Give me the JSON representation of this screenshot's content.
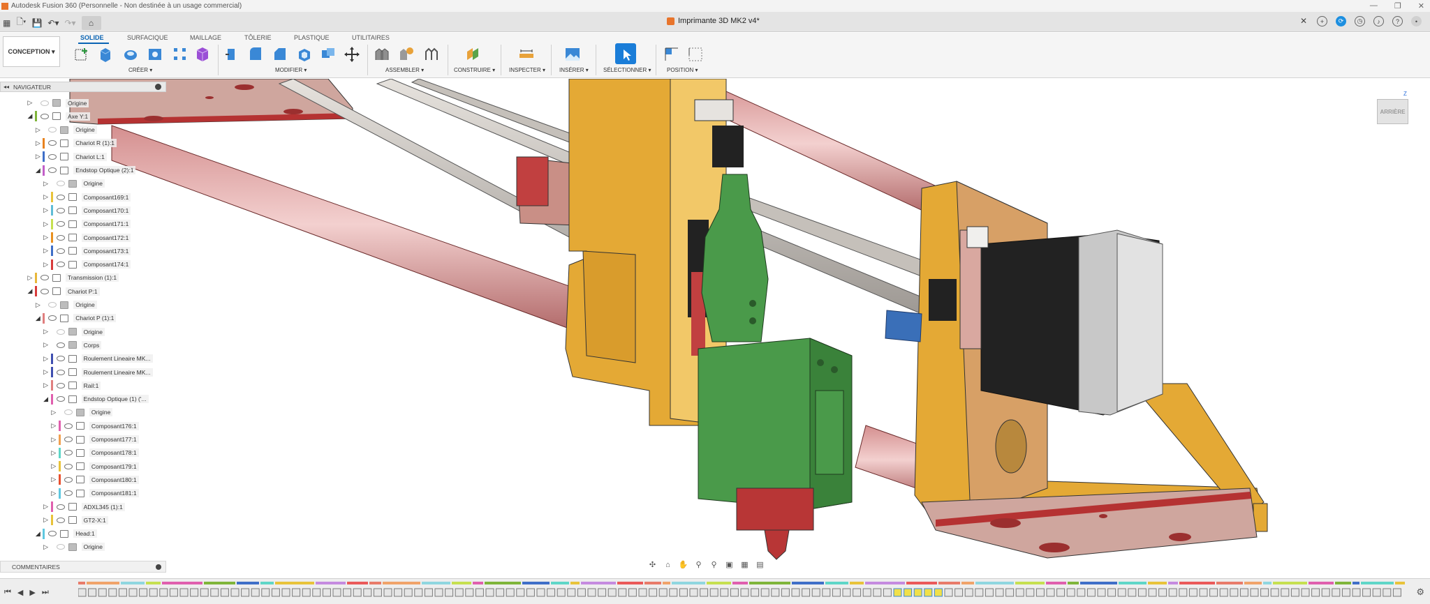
{
  "window": {
    "title": "Autodesk Fusion 360 (Personnelle - Non destinée à un usage commercial)",
    "controls": [
      "—",
      "❐",
      "✕"
    ]
  },
  "tabbar": {
    "document_title": "Imprimante 3D MK2 v4*",
    "close_glyph": "✕",
    "right_icons": [
      "plus-icon",
      "sync-icon",
      "clock-icon",
      "bell-icon",
      "help-icon",
      "user-icon"
    ]
  },
  "ribbon": {
    "workspace": "CONCEPTION",
    "tabs": [
      "SOLIDE",
      "SURFACIQUE",
      "MAILLAGE",
      "TÔLERIE",
      "PLASTIQUE",
      "UTILITAIRES"
    ],
    "active_tab": "SOLIDE",
    "groups": [
      "CRÉER",
      "MODIFIER",
      "ASSEMBLER",
      "CONSTRUIRE",
      "INSPECTER",
      "INSÉRER",
      "SÉLECTIONNER",
      "POSITION"
    ]
  },
  "browser": {
    "title": "NAVIGATEUR",
    "items": [
      {
        "label": "Origine",
        "type": "folder",
        "color": "",
        "expanded": false,
        "visible": false
      },
      {
        "label": "Axe Y:1",
        "type": "component",
        "color": "#7fb53a",
        "expanded": true,
        "visible": true
      },
      {
        "label": "Origine",
        "type": "folder",
        "color": "",
        "expanded": false,
        "visible": false
      },
      {
        "label": "Chariot R (1):1",
        "type": "component",
        "color": "#e8821e",
        "expanded": false,
        "visible": true
      },
      {
        "label": "Chariot L:1",
        "type": "component",
        "color": "#3f6fc8",
        "expanded": false,
        "visible": true
      },
      {
        "label": "Endstop Optique (2):1",
        "type": "component",
        "color": "#c25fc8",
        "expanded": true,
        "visible": true
      },
      {
        "label": "Origine",
        "type": "folder",
        "color": "",
        "expanded": false,
        "visible": false
      },
      {
        "label": "Composant169:1",
        "type": "body",
        "color": "#e8c33a",
        "expanded": false,
        "visible": true
      },
      {
        "label": "Composant170:1",
        "type": "body",
        "color": "#5fbcd6",
        "expanded": false,
        "visible": true
      },
      {
        "label": "Composant171:1",
        "type": "body",
        "color": "#c6e050",
        "expanded": false,
        "visible": true
      },
      {
        "label": "Composant172:1",
        "type": "body",
        "color": "#e8901f",
        "expanded": false,
        "visible": true
      },
      {
        "label": "Composant173:1",
        "type": "body",
        "color": "#3f6fc8",
        "expanded": false,
        "visible": true
      },
      {
        "label": "Composant174:1",
        "type": "body",
        "color": "#d83b3b",
        "expanded": false,
        "visible": true
      },
      {
        "label": "Transmission (1):1",
        "type": "component",
        "color": "#e8b73a",
        "expanded": false,
        "visible": true
      },
      {
        "label": "Chariot P:1",
        "type": "component",
        "color": "#d83b3b",
        "expanded": true,
        "visible": true
      },
      {
        "label": "Origine",
        "type": "folder",
        "color": "",
        "expanded": false,
        "visible": false
      },
      {
        "label": "Chariot P (1):1",
        "type": "component",
        "color": "#e07f7f",
        "expanded": true,
        "visible": true
      },
      {
        "label": "Origine",
        "type": "folder",
        "color": "",
        "expanded": false,
        "visible": false
      },
      {
        "label": "Corps",
        "type": "folder",
        "color": "",
        "expanded": false,
        "visible": true
      },
      {
        "label": "Roulement Lineaire MK...",
        "type": "component",
        "color": "#3f4fb0",
        "expanded": false,
        "visible": true
      },
      {
        "label": "Roulement Lineaire MK...",
        "type": "component",
        "color": "#3f4fb0",
        "expanded": false,
        "visible": true
      },
      {
        "label": "Rail:1",
        "type": "component",
        "color": "#e07f7f",
        "expanded": false,
        "visible": true
      },
      {
        "label": "Endstop Optique (1) ('...",
        "type": "component",
        "color": "#e05fae",
        "expanded": true,
        "visible": true
      },
      {
        "label": "Origine",
        "type": "folder",
        "color": "",
        "expanded": false,
        "visible": false
      },
      {
        "label": "Composant176:1",
        "type": "body",
        "color": "#e05fae",
        "expanded": false,
        "visible": true
      },
      {
        "label": "Composant177:1",
        "type": "body",
        "color": "#f0a050",
        "expanded": false,
        "visible": true
      },
      {
        "label": "Composant178:1",
        "type": "body",
        "color": "#5fd6c8",
        "expanded": false,
        "visible": true
      },
      {
        "label": "Composant179:1",
        "type": "body",
        "color": "#e8c33a",
        "expanded": false,
        "visible": true
      },
      {
        "label": "Composant180:1",
        "type": "body",
        "color": "#e8502f",
        "expanded": false,
        "visible": true
      },
      {
        "label": "Composant181:1",
        "type": "body",
        "color": "#5fc8e0",
        "expanded": false,
        "visible": true
      },
      {
        "label": "ADXL345 (1):1",
        "type": "component",
        "color": "#e05fae",
        "expanded": false,
        "visible": true
      },
      {
        "label": "GT2-X:1",
        "type": "component",
        "color": "#e8c33a",
        "expanded": false,
        "visible": true
      },
      {
        "label": "Head:1",
        "type": "component",
        "color": "#5fc8e0",
        "expanded": true,
        "visible": true
      },
      {
        "label": "Origine",
        "type": "folder",
        "color": "",
        "expanded": false,
        "visible": false
      }
    ]
  },
  "comments": {
    "title": "COMMENTAIRES"
  },
  "viewcube": {
    "face": "ARRIÈRE",
    "axis": "Z"
  },
  "navbar": {
    "icons": [
      "orbit-icon",
      "look-at-icon",
      "pan-icon",
      "zoom-icon",
      "zoom-window-icon",
      "display-settings-icon",
      "grid-icon",
      "viewports-icon"
    ]
  },
  "timeline": {
    "controls": [
      "⏮",
      "◀",
      "▶",
      "⏭"
    ]
  }
}
